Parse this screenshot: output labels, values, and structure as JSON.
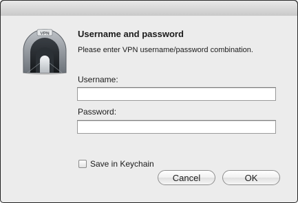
{
  "dialog": {
    "icon": "vpn-tunnel-icon",
    "icon_badge": "VPN",
    "heading": "Username and password",
    "message": "Please enter VPN username/password combination.",
    "username_label": "Username:",
    "username_value": "",
    "password_label": "Password:",
    "password_value": "",
    "save_keychain_label": "Save in Keychain",
    "save_keychain_checked": false,
    "cancel_label": "Cancel",
    "ok_label": "OK"
  }
}
